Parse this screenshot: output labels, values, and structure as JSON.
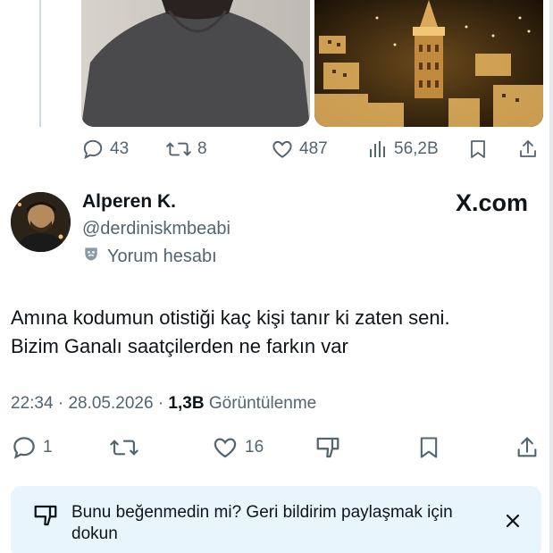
{
  "parent_tweet": {
    "actions": {
      "replies": "43",
      "retweets": "8",
      "likes": "487",
      "views": "56,2B"
    }
  },
  "reply_tweet": {
    "author_name": "Alperen K.",
    "author_handle": "@derdiniskmbeabi",
    "account_tag": "Yorum hesabı",
    "watermark": "X.com",
    "text_line1": "Amına kodumun otistiği kaç kişi tanır ki zaten seni.",
    "text_line2": "Bizim Ganalı saatçilerden ne farkın var",
    "time": "22:34",
    "date": "28.05.2026",
    "views_count": "1,3B",
    "views_label": "Görüntülenme",
    "actions": {
      "replies": "1",
      "likes": "16"
    }
  },
  "feedback": {
    "text": "Bunu beğenmedin mi? Geri bildirim paylaşmak için dokun"
  },
  "colors": {
    "secondary_text": "#536471",
    "primary_text": "#0f1419",
    "feedback_bg": "#e8f5fd"
  },
  "icons": {
    "reply": "speech-bubble-icon",
    "retweet": "retweet-icon",
    "like": "heart-icon",
    "views": "bar-chart-icon",
    "bookmark": "bookmark-icon",
    "share": "share-icon",
    "dislike": "thumbs-down-icon",
    "close": "close-icon",
    "mask": "theater-mask-icon"
  }
}
